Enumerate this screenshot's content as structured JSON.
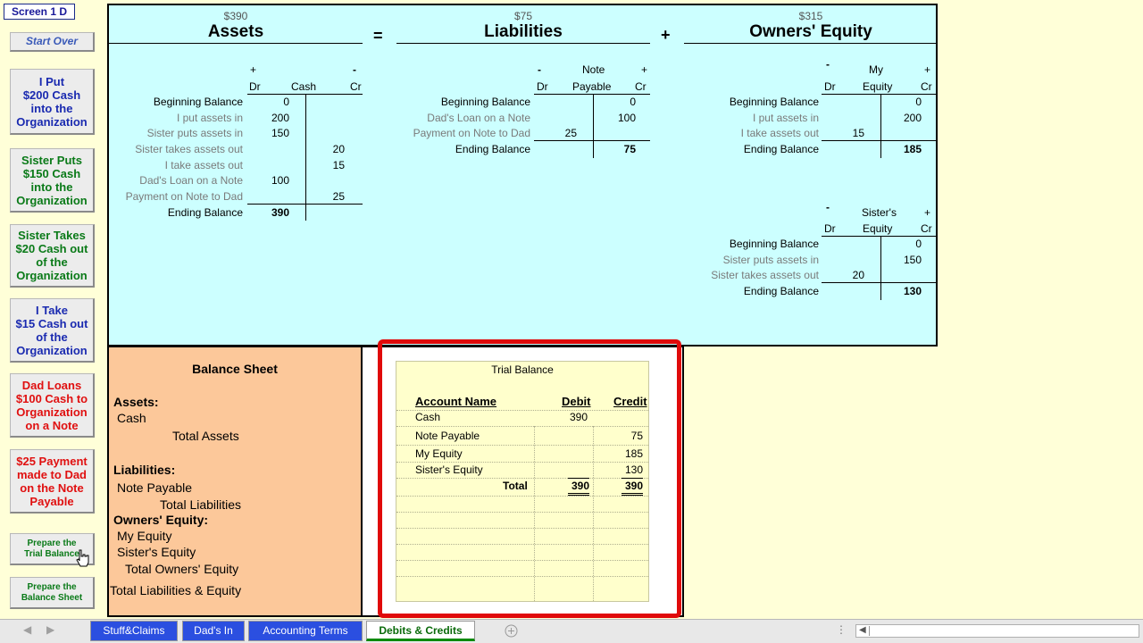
{
  "screen_label": "Screen 1 D",
  "buttons": {
    "start_over": "Start Over",
    "put_cash": "I Put\n$200 Cash\ninto the\nOrganization",
    "sister_puts": "Sister Puts\n$150 Cash\ninto the\nOrganization",
    "sister_takes": "Sister Takes\n$20 Cash out\nof the\nOrganization",
    "i_take": "I Take\n$15 Cash out\nof the\nOrganization",
    "dad_loans": "Dad Loans\n$100 Cash to\nOrganization\non a Note",
    "payment": "$25 Payment\nmade to Dad\non the Note\nPayable",
    "trial_balance": "Prepare the\nTrial Balance",
    "balance_sheet": "Prepare the\nBalance Sheet"
  },
  "equation": {
    "assets_amount": "$390",
    "assets_title": "Assets",
    "eq": "=",
    "liabilities_amount": "$75",
    "liabilities_title": "Liabilities",
    "plus": "+",
    "equity_amount": "$315",
    "equity_title": "Owners' Equity"
  },
  "cash": {
    "plus": "+",
    "minus": "-",
    "dr": "Dr",
    "cr": "Cr",
    "name": "Cash",
    "rows": [
      {
        "label": "Beginning Balance",
        "dr": "0",
        "cr": ""
      },
      {
        "label": "I put assets in",
        "dr": "200",
        "cr": ""
      },
      {
        "label": "Sister puts assets in",
        "dr": "150",
        "cr": ""
      },
      {
        "label": "Sister takes assets out",
        "dr": "",
        "cr": "20"
      },
      {
        "label": "I take assets out",
        "dr": "",
        "cr": "15"
      },
      {
        "label": "Dad's Loan on a Note",
        "dr": "100",
        "cr": ""
      },
      {
        "label": "Payment on Note to Dad",
        "dr": "",
        "cr": "25"
      },
      {
        "label": "Ending Balance",
        "dr": "390",
        "cr": ""
      }
    ]
  },
  "note": {
    "minus": "-",
    "plus": "+",
    "dr": "Dr",
    "cr": "Cr",
    "name1": "Note",
    "name2": "Payable",
    "rows": [
      {
        "label": "Beginning Balance",
        "dr": "",
        "cr": "0"
      },
      {
        "label": "Dad's Loan on a Note",
        "dr": "",
        "cr": "100"
      },
      {
        "label": "Payment on Note to Dad",
        "dr": "25",
        "cr": ""
      },
      {
        "label": "Ending Balance",
        "dr": "",
        "cr": "75"
      }
    ]
  },
  "myequity": {
    "minus": "-",
    "plus": "+",
    "dr": "Dr",
    "cr": "Cr",
    "name1": "My",
    "name2": "Equity",
    "rows": [
      {
        "label": "Beginning Balance",
        "dr": "",
        "cr": "0"
      },
      {
        "label": "I put assets in",
        "dr": "",
        "cr": "200"
      },
      {
        "label": "I take assets out",
        "dr": "15",
        "cr": ""
      },
      {
        "label": "Ending Balance",
        "dr": "",
        "cr": "185"
      }
    ]
  },
  "sisequity": {
    "minus": "-",
    "plus": "+",
    "dr": "Dr",
    "cr": "Cr",
    "name1": "Sister's",
    "name2": "Equity",
    "rows": [
      {
        "label": "Beginning Balance",
        "dr": "",
        "cr": "0"
      },
      {
        "label": "Sister puts assets in",
        "dr": "",
        "cr": "150"
      },
      {
        "label": "Sister takes assets out",
        "dr": "20",
        "cr": ""
      },
      {
        "label": "Ending Balance",
        "dr": "",
        "cr": "130"
      }
    ]
  },
  "balance_sheet": {
    "title": "Balance Sheet",
    "assets": "Assets:",
    "cash": "Cash",
    "total_assets": "Total Assets",
    "liabilities": "Liabilities:",
    "note_payable": "Note Payable",
    "total_liabilities": "Total Liabilities",
    "owners_equity": "Owners' Equity:",
    "my_equity": "My Equity",
    "sisters_equity": "Sister's Equity",
    "total_owners_equity": "Total Owners' Equity",
    "total_liab_equity": "Total Liabilities & Equity"
  },
  "trial_balance": {
    "title": "Trial Balance",
    "col_account": "Account Name",
    "col_debit": "Debit",
    "col_credit": "Credit",
    "rows": [
      {
        "account": "Cash",
        "debit": "390",
        "credit": ""
      },
      {
        "account": "Note Payable",
        "debit": "",
        "credit": "75"
      },
      {
        "account": "My Equity",
        "debit": "",
        "credit": "185"
      },
      {
        "account": "Sister's Equity",
        "debit": "",
        "credit": "130"
      }
    ],
    "total_label": "Total",
    "total_debit": "390",
    "total_credit": "390"
  },
  "tabs": [
    "Stuff&Claims",
    "Dad's In",
    "Accounting Terms",
    "Debits & Credits"
  ],
  "active_tab": "Debits & Credits",
  "colors": {
    "tab_blue": "#2b4fe0",
    "panel_cyan": "#ccffff",
    "panel_orange": "#fcc89a",
    "annotation_red": "#e00a0a"
  }
}
